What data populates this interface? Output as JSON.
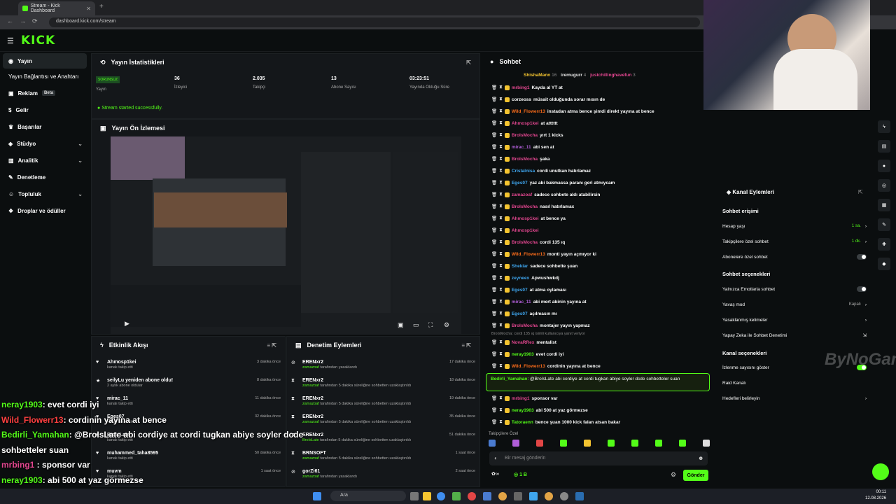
{
  "browser": {
    "tab_title": "Stream - Kick Dashboard",
    "new_tab": "+",
    "url": "dashboard.kick.com/stream"
  },
  "header": {
    "logo": "KICK"
  },
  "sidebar": {
    "items": [
      {
        "label": "Yayın",
        "icon": "broadcast-icon"
      },
      {
        "label": "Yayın Bağlantısı ve Anahtarı",
        "icon": ""
      },
      {
        "label": "Reklam",
        "icon": "ad-icon",
        "badge": "Beta"
      },
      {
        "label": "Gelir",
        "icon": "money-icon"
      },
      {
        "label": "Başarılar",
        "icon": "trophy-icon"
      },
      {
        "label": "Stüdyo",
        "icon": "studio-icon"
      },
      {
        "label": "Analitik",
        "icon": "chart-icon"
      },
      {
        "label": "Denetleme",
        "icon": "wrench-icon"
      },
      {
        "label": "Topluluk",
        "icon": "people-icon"
      },
      {
        "label": "Droplar ve ödüller",
        "icon": "gift-icon"
      }
    ]
  },
  "stats": {
    "title": "Yayın İstatistikleri",
    "status_badge": "SORUNSUZ",
    "status_label": "Yayın",
    "viewers": "36",
    "viewers_label": "İzleyici",
    "followers": "2.035",
    "followers_label": "Takipçi",
    "subs": "13",
    "subs_label": "Abone Sayısı",
    "uptime": "03:23:51",
    "uptime_label": "Yayında Olduğu Süre",
    "started_msg": "Stream started successfully."
  },
  "preview": {
    "title": "Yayın Ön İzlemesi"
  },
  "activity": {
    "title": "Etkinlik Akışı",
    "rows": [
      {
        "name": "Ahmosp1kei",
        "desc": "kanalı takip etti",
        "time": "3 dakika önce",
        "icon": "♥"
      },
      {
        "name": "seilyLu yeniden abone oldu!",
        "desc": "2 aylık abone oldular",
        "time": "8 dakika önce",
        "icon": "★"
      },
      {
        "name": "mirac_11",
        "desc": "kanalı takip etti",
        "time": "11 dakika önce",
        "icon": "♥"
      },
      {
        "name": "Eges07",
        "desc": "kanalı takip etti",
        "time": "32 dakika önce",
        "icon": "♥"
      },
      {
        "name": "BroIsLate",
        "desc": "kanalı takip etti",
        "time": "",
        "icon": "♥"
      },
      {
        "name": "muhammed_taha8595",
        "desc": "kanalı takip etti",
        "time": "50 dakika önce",
        "icon": "♥"
      },
      {
        "name": "muvm",
        "desc": "kanalı takip etti",
        "time": "1 saat önce",
        "icon": "♥"
      }
    ]
  },
  "moderation": {
    "title": "Denetim Eylemleri",
    "rows": [
      {
        "name": "ERENxr2",
        "by": "zamazoaf",
        "desc": "tarafından yasaklandı",
        "time": "17 dakika önce",
        "icon": "⊘"
      },
      {
        "name": "ERENxr2",
        "by": "zamazoaf",
        "desc": "tarafından 5 dakika süreliğine sohbetten uzaklaştırıldı",
        "time": "18 dakika önce",
        "icon": "⧗"
      },
      {
        "name": "ERENxr2",
        "by": "zamazoaf",
        "desc": "tarafından 5 dakika süreliğine sohbetten uzaklaştırıldı",
        "time": "19 dakika önce",
        "icon": "⧗"
      },
      {
        "name": "ERENxr2",
        "by": "zamazoaf",
        "desc": "tarafından 5 dakika süreliğine sohbetten uzaklaştırıldı",
        "time": "35 dakika önce",
        "icon": "⧗"
      },
      {
        "name": "ERENxr2",
        "by": "BroIsLate",
        "desc": "tarafından 5 dakika süreliğine sohbetten uzaklaştırıldı",
        "time": "51 dakika önce",
        "icon": "⧗"
      },
      {
        "name": "BRNSOFT",
        "by": "zamazoaf",
        "desc": "tarafından 5 dakika süreliğine sohbetten uzaklaştırıldı",
        "time": "1 saat önce",
        "icon": "⧗"
      },
      {
        "name": "gorZi61",
        "by": "zamazoaf",
        "desc": "tarafından yasaklandı",
        "time": "2 saat önce",
        "icon": "⊘"
      }
    ]
  },
  "chat": {
    "title": "Sohbet",
    "top_users": [
      {
        "name": "ShishaMann",
        "n": "16"
      },
      {
        "name": "iremugurr",
        "n": "4"
      },
      {
        "name": "justchillinghavefun",
        "n": "3"
      }
    ],
    "messages": [
      {
        "user": "mrbing1",
        "color": "#e2468f",
        "text": "Kayda al YT at"
      },
      {
        "user": "corzeoss",
        "color": "#ffffff",
        "text": "müsait olduğunda sorar mısın de"
      },
      {
        "user": "Wild_Flowerr13",
        "color": "#f96b1a",
        "text": "instadan atma bence şimdi direkt yayına at bence"
      },
      {
        "user": "Ahmosp1kei",
        "color": "#e2468f",
        "text": "at atttttt"
      },
      {
        "user": "BroIsMocha",
        "color": "#e2468f",
        "text": "yırt 1 kicks"
      },
      {
        "user": "mirac_11",
        "color": "#b05ed8",
        "text": "abi sen at"
      },
      {
        "user": "BroIsMocha",
        "color": "#e2468f",
        "text": "şaka"
      },
      {
        "user": "Cristalnisa",
        "color": "#3fa6ef",
        "text": "cordi unutkan hatırlamaz"
      },
      {
        "user": "Eges07",
        "color": "#3fa6ef",
        "text": "yaz abi bakmassa paranı geri atmıycam"
      },
      {
        "user": "zamazoaf",
        "color": "#e2468f",
        "text": "sadece sohbete aldı atabilirsin"
      },
      {
        "user": "BroIsMocha",
        "color": "#e2468f",
        "text": "nasıl hatırlamax"
      },
      {
        "user": "Ahmosp1kei",
        "color": "#e2468f",
        "text": "at bence ya"
      },
      {
        "user": "Ahmosp1kei",
        "color": "#e2468f",
        "text": ""
      },
      {
        "user": "BroIsMocha",
        "color": "#e2468f",
        "text": "cordi 135 ıq"
      },
      {
        "user": "Wild_Flowerr13",
        "color": "#f96b1a",
        "text": "monti yayın açmıyor ki"
      },
      {
        "user": "Sheklar",
        "color": "#3fa6ef",
        "text": "sadece sohbette şuan"
      },
      {
        "user": "zeyneex",
        "color": "#3fa6ef",
        "text": "Apwushwkdj"
      },
      {
        "user": "Eges07",
        "color": "#3fa6ef",
        "text": "at atma oylaması"
      },
      {
        "user": "mirac_11",
        "color": "#b05ed8",
        "text": "abi mert abinin yayına at"
      },
      {
        "user": "Eges07",
        "color": "#3fa6ef",
        "text": "açılmasın mı"
      },
      {
        "user": "BroIsMocha",
        "color": "#e2468f",
        "text": "montajer yayın yapmaz"
      }
    ],
    "reply_hint": "BroIsMocha: cordi 135 ıq isimli kullanıcıya yanıt veriyor",
    "messages2": [
      {
        "user": "NovaRRex",
        "color": "#e2468f",
        "text": "mentalist"
      },
      {
        "user": "neray1903",
        "color": "#53fc18",
        "text": "evet cordi iyi"
      },
      {
        "user": "Wild_Flowerr13",
        "color": "#f96b1a",
        "text": "cordinin yayına at bence"
      }
    ],
    "highlight": {
      "user": "Bedirli_Yamahan",
      "text": "@BroIsLate abi cordiye at cordi tugkan abiye soyler dcde sohbetteler suan"
    },
    "messages3": [
      {
        "user": "mrbing1",
        "color": "#e2468f",
        "text": "sponsor var"
      },
      {
        "user": "neray1903",
        "color": "#53fc18",
        "text": "abi 500 at yaz görmezse"
      },
      {
        "user": "Tatoraenn",
        "color": "#53fc18",
        "text": "bence şuan 1000 kick falan atsan bakar"
      }
    ],
    "followers_only": "Takipçilere Özel",
    "input_placeholder": "Bir mesaj gönderin",
    "footer_count": "1 B",
    "send": "Gönder"
  },
  "channel_actions": {
    "title": "Kanal Eylemleri",
    "sec1": "Sohbet erişimi",
    "items1": [
      {
        "label": "Hesap yaşı",
        "value": "1 sa."
      },
      {
        "label": "Takipçilere özel sohbet",
        "value": "1 dk."
      },
      {
        "label": "Abonelere özel sohbet",
        "value": ""
      }
    ],
    "sec2": "Sohbet seçenekleri",
    "items2": [
      {
        "label": "Yalnızca Emotlarla sohbet",
        "value": ""
      },
      {
        "label": "Yavaş mod",
        "value": "Kapalı"
      },
      {
        "label": "Yasaklanmış kelimeler",
        "value": ""
      },
      {
        "label": "Yapay Zeka ile Sohbet Denetimi",
        "value": ""
      }
    ],
    "sec3": "Kanal seçenekleri",
    "items3": [
      {
        "label": "İzlenme sayısını göster",
        "value": ""
      },
      {
        "label": "Raid Kanalı",
        "value": ""
      },
      {
        "label": "Hedefleri belirleyin",
        "value": ""
      }
    ]
  },
  "overlay": [
    {
      "user": "neray1903",
      "color": "#53fc18",
      "text": ": evet cordi iyi"
    },
    {
      "user": "Wild_Flowerr13",
      "color": "#ff4040",
      "text": ": cordinin yayına at bence"
    },
    {
      "user": "Bedirli_Yamahan",
      "color": "#53fc18",
      "text": ": @BroIsLate abi cordiye at cordi tugkan abiye soyler dcde"
    },
    {
      "user": "",
      "color": "#fff",
      "text": "sohbetteler suan"
    },
    {
      "user": "mrbing1",
      "color": "#e2468f",
      "text": " : sponsor var"
    },
    {
      "user": "neray1903",
      "color": "#53fc18",
      "text": ": abi 500 at yaz görmezse"
    },
    {
      "user": "Tatoraenn",
      "color": "#53fc18",
      "text": ": bence şuan 1000 kick falan atsan bakar"
    }
  ],
  "taskbar": {
    "search": "Ara",
    "time": "00:11",
    "date": "12.08.2026"
  },
  "watermark": "ByNoGame"
}
